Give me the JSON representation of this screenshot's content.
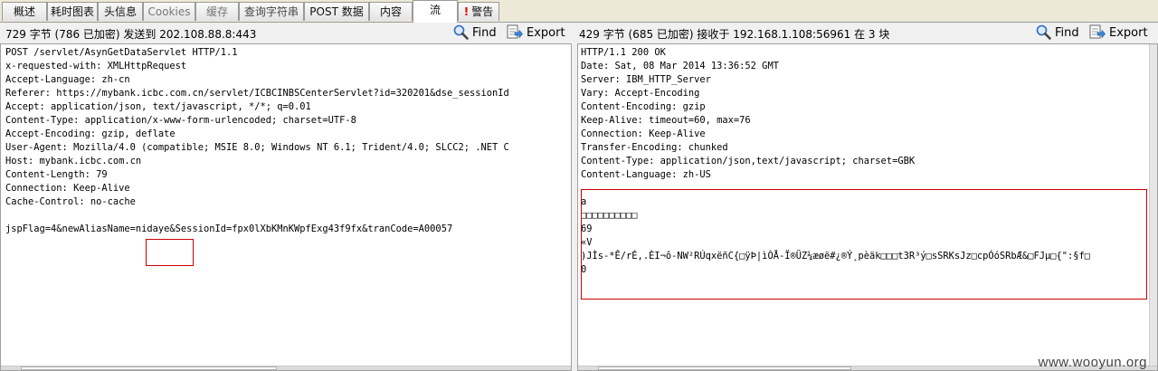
{
  "tabs": [
    {
      "label": "概述"
    },
    {
      "label": "耗时图表"
    },
    {
      "label": "头信息"
    },
    {
      "label": "Cookies"
    },
    {
      "label": "缓存"
    },
    {
      "label": "查询字符串"
    },
    {
      "label": "POST 数据"
    },
    {
      "label": "内容"
    },
    {
      "label": "流",
      "active": true
    },
    {
      "label": "警告",
      "icon": "warning-icon"
    }
  ],
  "request": {
    "summary": "729 字节 (786 已加密) 发送到 202.108.88.8:443",
    "find_label": "Find",
    "export_label": "Export",
    "lines": [
      "POST /servlet/AsynGetDataServlet HTTP/1.1",
      "x-requested-with: XMLHttpRequest",
      "Accept-Language: zh-cn",
      "Referer: https://mybank.icbc.com.cn/servlet/ICBCINBSCenterServlet?id=320201&dse_sessionId",
      "Accept: application/json, text/javascript, */*; q=0.01",
      "Content-Type: application/x-www-form-urlencoded; charset=UTF-8",
      "Accept-Encoding: gzip, deflate",
      "User-Agent: Mozilla/4.0 (compatible; MSIE 8.0; Windows NT 6.1; Trident/4.0; SLCC2; .NET C",
      "Host: mybank.icbc.com.cn",
      "Content-Length: 79",
      "Connection: Keep-Alive",
      "Cache-Control: no-cache",
      "",
      "jspFlag=4&newAliasName=nidaye&SessionId=fpx0lXbKMnKWpfExg43f9fx&tranCode=A00057"
    ]
  },
  "response": {
    "summary": "429 字节 (685 已加密) 接收于 192.168.1.108:56961 在 3 块",
    "find_label": "Find",
    "export_label": "Export",
    "header_lines": [
      "HTTP/1.1 200 OK",
      "Date: Sat, 08 Mar 2014 13:36:52 GMT",
      "Server: IBM_HTTP_Server",
      "Vary: Accept-Encoding",
      "Content-Encoding: gzip",
      "Keep-Alive: timeout=60, max=76",
      "Connection: Keep-Alive",
      "Transfer-Encoding: chunked",
      "Content-Type: application/json,text/javascript; charset=GBK",
      "Content-Language: zh-US"
    ],
    "body_lines": [
      "a",
      "□□□□□□□□□□",
      "69",
      "«V",
      ")JÌs-*Ê/rÉ,.ÈI¬ô-NW²RÚqxëñC{□ÿÞ|ìÒÅ-Ï®ÜZ¼æøë#¿®Ý¸pèäk□□□t3R³ý□sSRKsJz□cpÓóSRbÆ&□FJµ□{\":§f□",
      "0"
    ]
  },
  "watermark": "www.wooyun.org"
}
